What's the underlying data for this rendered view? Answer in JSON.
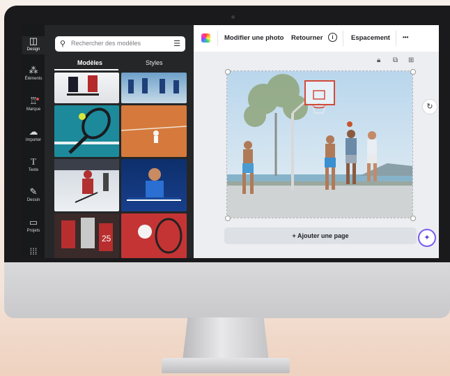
{
  "search": {
    "placeholder": "Rechercher des modèles"
  },
  "panel_tabs": [
    {
      "label": "Modèles"
    },
    {
      "label": "Styles"
    }
  ],
  "rail": [
    {
      "icon": "layout-icon",
      "label": "Design"
    },
    {
      "icon": "elements-icon",
      "label": "Éléments"
    },
    {
      "icon": "brand-icon",
      "label": "Marque"
    },
    {
      "icon": "upload-icon",
      "label": "Importer"
    },
    {
      "icon": "text-icon",
      "label": "Texte"
    },
    {
      "icon": "draw-icon",
      "label": "Dessin"
    },
    {
      "icon": "folder-icon",
      "label": "Projets"
    },
    {
      "icon": "apps-grid-icon",
      "label": ""
    }
  ],
  "toolbar": {
    "edit_photo": "Modifier une photo",
    "flip": "Retourner",
    "info": "i",
    "spacing": "Espacement",
    "more": "•••"
  },
  "canvas": {
    "add_page": "+ Ajouter une page"
  },
  "thumb_badge": "25",
  "colors": {
    "rail_bg": "#18191b",
    "panel_bg": "#252627",
    "accent": "#7b5cf0"
  }
}
